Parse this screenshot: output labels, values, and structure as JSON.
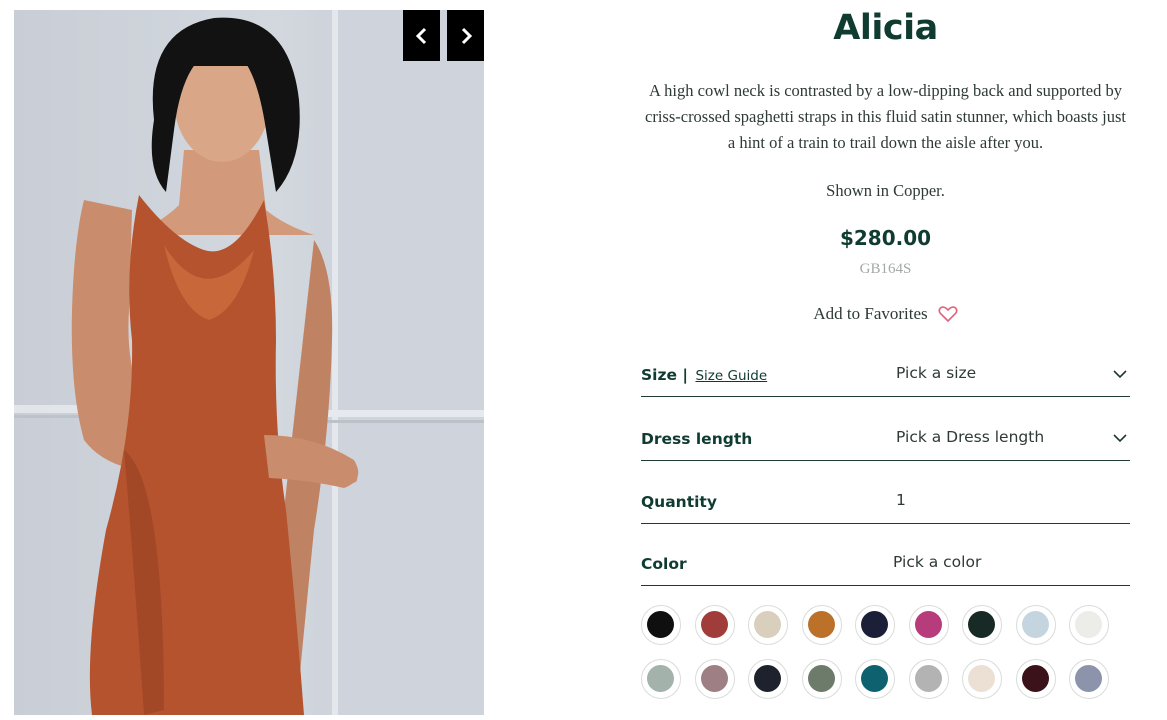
{
  "product": {
    "name": "Alicia",
    "description": "A high cowl neck is contrasted by a low-dipping back and supported by criss-crossed spaghetti straps in this fluid satin stunner, which boasts just a hint of a train to trail down the aisle after you.",
    "shown_in": "Shown in Copper.",
    "price": "$280.00",
    "sku": "GB164S",
    "favorites_label": "Add to Favorites"
  },
  "gallery": {
    "prev_icon": "chevron-left-icon",
    "next_icon": "chevron-right-icon",
    "dress_color": "#b5532f"
  },
  "options": {
    "size": {
      "label": "Size |",
      "guide_link": "Size Guide",
      "value": "Pick a size"
    },
    "length": {
      "label": "Dress length",
      "value": "Pick a Dress length"
    },
    "quantity": {
      "label": "Quantity",
      "value": "1"
    },
    "color": {
      "label": "Color",
      "value": "Pick a color"
    }
  },
  "swatches": [
    "#0f0f0f",
    "#a03d3a",
    "#d8d0bc",
    "#bb7129",
    "#1b2038",
    "#b73c7c",
    "#182a26",
    "#c5d5df",
    "#ecece8",
    "#a3b2aa",
    "#9e8084",
    "#1e222c",
    "#6c7b6a",
    "#0e6270",
    "#b3b3b3",
    "#ecdfd4",
    "#3b1219",
    "#8b94ab"
  ],
  "colors": {
    "accent": "#0f3b30",
    "heart": "#e0637d",
    "nav_bg": "#000000"
  }
}
